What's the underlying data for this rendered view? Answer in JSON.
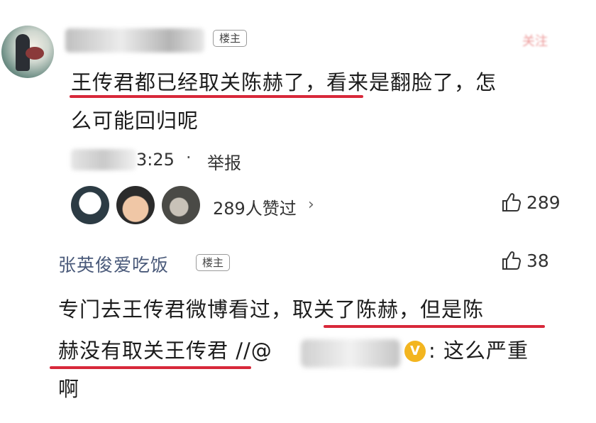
{
  "comment": {
    "owner_badge": "楼主",
    "follow_label": "关注",
    "text_line1_underlined": "王传君都已经取关陈赫了，",
    "text_line1_rest": "看来是翻脸了，怎",
    "text_line2": "么可能回归呢",
    "time_suffix": "3:25",
    "separator": "·",
    "report_label": "举报",
    "likers_text": "289人赞过",
    "likers_chevron": "›",
    "like_count": "289"
  },
  "reply": {
    "author": "张英俊爱吃饭",
    "owner_badge": "楼主",
    "like_count": "38",
    "line1_plain": "专门去王传君微博看过，",
    "line1_underlined": "取关了陈赫，但是陈",
    "line2_underlined": "赫没有取关王传君",
    "line2_tail": " //@",
    "verified_mark": "V",
    "line2_after": ": 这么严重",
    "line3": "啊"
  },
  "colors": {
    "underline": "#d8283a",
    "author_link": "#4a5a7a",
    "verified": "#f3b51f"
  }
}
